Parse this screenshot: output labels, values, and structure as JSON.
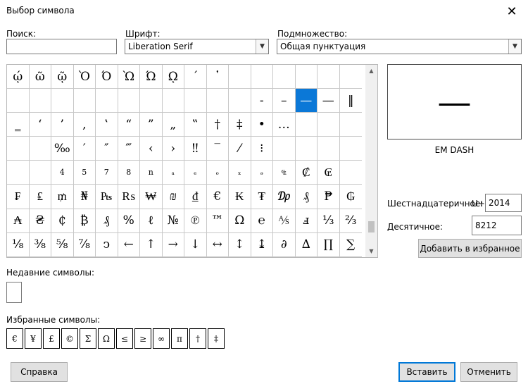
{
  "window": {
    "title": "Выбор символа",
    "close_glyph": "✕"
  },
  "search": {
    "label": "Поиск:",
    "value": ""
  },
  "font": {
    "label": "Шрифт:",
    "value": "Liberation Serif"
  },
  "subset": {
    "label": "Подмножество:",
    "value": "Общая пунктуация"
  },
  "grid": {
    "cells": [
      "ῴ",
      "ῶ",
      "ῷ",
      "Ὸ",
      "Ό",
      "Ὼ",
      "Ώ",
      "ῼ",
      "´",
      "῾",
      "",
      "",
      "",
      "",
      "",
      "",
      "",
      "",
      "",
      "",
      "",
      "",
      "",
      "",
      "",
      "",
      "",
      "-",
      "–",
      "—",
      "—",
      "‖",
      "‗",
      "‘",
      "’",
      "‚",
      "‛",
      "“",
      "”",
      "„",
      "‟",
      "†",
      "‡",
      "•",
      "…",
      "",
      "",
      "",
      "",
      "",
      "‰",
      "′",
      "″",
      "‴",
      "‹",
      "›",
      "‼",
      "‾",
      "⁄",
      "⁝",
      "",
      "",
      "",
      "",
      "",
      "",
      "4",
      "5",
      "7",
      "8",
      "n",
      "ₐ",
      "ₑ",
      "ₒ",
      "ₓ",
      "ₔ",
      "₠",
      "₡",
      "₢",
      "",
      "₣",
      "₤",
      "₥",
      "₦",
      "₧",
      "₨",
      "₩",
      "₪",
      "₫",
      "€",
      "₭",
      "₮",
      "₯",
      "₰",
      "₱",
      "₲",
      "₳",
      "₴",
      "₵",
      "₿",
      "₰",
      "%",
      "ℓ",
      "№",
      "℗",
      "™",
      "Ω",
      "℮",
      "⅍",
      "ⅎ",
      "⅓",
      "⅔",
      "⅛",
      "⅜",
      "⅝",
      "⅞",
      "ↄ",
      "←",
      "↑",
      "→",
      "↓",
      "↔",
      "↕",
      "↨",
      "∂",
      "∆",
      "∏",
      "∑"
    ],
    "selected_index": 29
  },
  "preview": {
    "glyph": "—",
    "name": "EM DASH"
  },
  "hex": {
    "label": "Шестнадцатеричное:",
    "prefix": "U+",
    "value": "2014"
  },
  "dec": {
    "label": "Десятичное:",
    "value": "8212"
  },
  "add_favorite_label": "Добавить в избранное",
  "recent": {
    "label": "Недавние символы:"
  },
  "favorites": {
    "label": "Избранные символы:",
    "items": [
      "€",
      "¥",
      "£",
      "©",
      "Σ",
      "Ω",
      "≤",
      "≥",
      "∞",
      "π",
      "†",
      "‡"
    ]
  },
  "buttons": {
    "help": "Справка",
    "insert": "Вставить",
    "cancel": "Отменить"
  }
}
